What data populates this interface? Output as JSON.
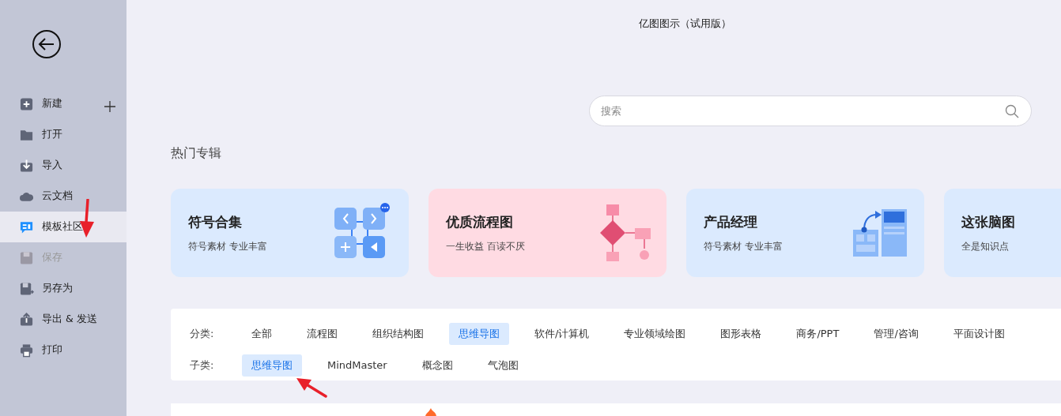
{
  "window": {
    "title": "亿图图示（试用版）"
  },
  "sidebar": {
    "items": [
      {
        "label": "新建",
        "kind": "new",
        "selected": false,
        "disabled": false
      },
      {
        "label": "打开",
        "kind": "open",
        "selected": false,
        "disabled": false
      },
      {
        "label": "导入",
        "kind": "import",
        "selected": false,
        "disabled": false
      },
      {
        "label": "云文档",
        "kind": "cloud",
        "selected": false,
        "disabled": false
      },
      {
        "label": "模板社区",
        "kind": "community",
        "selected": true,
        "disabled": false
      },
      {
        "label": "保存",
        "kind": "save",
        "selected": false,
        "disabled": true
      },
      {
        "label": "另存为",
        "kind": "saveas",
        "selected": false,
        "disabled": false
      },
      {
        "label": "导出 & 发送",
        "kind": "export",
        "selected": false,
        "disabled": false
      },
      {
        "label": "打印",
        "kind": "print",
        "selected": false,
        "disabled": false
      }
    ]
  },
  "search": {
    "placeholder": "搜索"
  },
  "section_title": "热门专辑",
  "albums": [
    {
      "title": "符号合集",
      "subtitle": "符号素材 专业丰富",
      "kind": "symbols"
    },
    {
      "title": "优质流程图",
      "subtitle": "一生收益 百读不厌",
      "kind": "flowchart"
    },
    {
      "title": "产品经理",
      "subtitle": "符号素材 专业丰富",
      "kind": "product"
    },
    {
      "title": "这张脑图",
      "subtitle": "全是知识点",
      "kind": "none"
    }
  ],
  "categories": {
    "label": "分类:",
    "items": [
      {
        "label": "全部",
        "selected": false
      },
      {
        "label": "流程图",
        "selected": false
      },
      {
        "label": "组织结构图",
        "selected": false
      },
      {
        "label": "思维导图",
        "selected": true
      },
      {
        "label": "软件/计算机",
        "selected": false
      },
      {
        "label": "专业领域绘图",
        "selected": false
      },
      {
        "label": "图形表格",
        "selected": false
      },
      {
        "label": "商务/PPT",
        "selected": false
      },
      {
        "label": "管理/咨询",
        "selected": false
      },
      {
        "label": "平面设计图",
        "selected": false
      }
    ]
  },
  "subcategories": {
    "label": "子类:",
    "items": [
      {
        "label": "思维导图",
        "selected": true
      },
      {
        "label": "MindMaster",
        "selected": false
      },
      {
        "label": "概念图",
        "selected": false
      },
      {
        "label": "气泡图",
        "selected": false
      }
    ]
  },
  "annotation_arrows": [
    {
      "kind": "down"
    },
    {
      "kind": "up-left"
    }
  ]
}
